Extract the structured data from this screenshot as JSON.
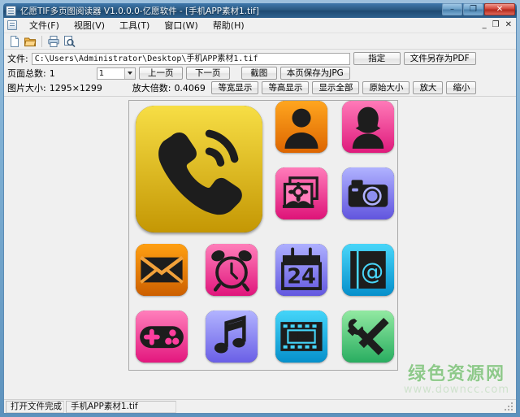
{
  "window": {
    "title": "亿愿TIF多页图阅读器 V1.0.0.0-亿愿软件 - [手机APP素材1.tif]",
    "icon": "app-icon",
    "minimize": "–",
    "maximize": "❐",
    "close": "✕"
  },
  "mdi": {
    "minimize": "_",
    "restore": "❐",
    "close": "✕"
  },
  "menu": {
    "items": [
      {
        "label": "文件(F)",
        "name": "menu-file"
      },
      {
        "label": "视图(V)",
        "name": "menu-view"
      },
      {
        "label": "工具(T)",
        "name": "menu-tools"
      },
      {
        "label": "窗口(W)",
        "name": "menu-window"
      },
      {
        "label": "帮助(H)",
        "name": "menu-help"
      }
    ]
  },
  "toolbar": {
    "icons": [
      "new-file-icon",
      "open-folder-icon",
      "print-icon",
      "print-preview-icon"
    ]
  },
  "file_row": {
    "label": "文件:",
    "path": "C:\\Users\\Administrator\\Desktop\\手机APP素材1.tif",
    "placeholder": "",
    "specify_button": "指定",
    "save_pdf_button": "文件另存为PDF"
  },
  "page_row": {
    "total_label": "页面总数:",
    "total_value": "1",
    "page_select_value": "1",
    "prev_button": "上一页",
    "next_button": "下一页",
    "capture_button": "截图",
    "save_jpg_button": "本页保存为JPG"
  },
  "zoom_row": {
    "size_label": "图片大小:",
    "size_value": "1295×1299",
    "scale_label": "放大倍数:",
    "scale_value": "0.4069",
    "fit_width_button": "等宽显示",
    "fit_height_button": "等高显示",
    "fit_all_button": "显示全部",
    "original_size_button": "原始大小",
    "zoom_in_button": "放大",
    "zoom_out_button": "缩小"
  },
  "image": {
    "icons": [
      {
        "name": "phone-icon",
        "c1": "#f5d93a",
        "c2": "#c79a05",
        "span": "big"
      },
      {
        "name": "contact-male-icon",
        "c1": "#ff9f1a",
        "c2": "#e06a00"
      },
      {
        "name": "contact-female-icon",
        "c1": "#ff74b4",
        "c2": "#e11f7e"
      },
      {
        "name": "gallery-icon",
        "c1": "#ff77b9",
        "c2": "#e01579"
      },
      {
        "name": "camera-icon",
        "c1": "#a6a8f8",
        "c2": "#6a5fe0"
      },
      {
        "name": "mail-icon",
        "c1": "#ff9a0d",
        "c2": "#cf6200"
      },
      {
        "name": "alarm-clock-icon",
        "c1": "#ff79b5",
        "c2": "#e3187c"
      },
      {
        "name": "calendar-icon",
        "c1": "#a4a6f9",
        "c2": "#6a5fe2",
        "day": "24"
      },
      {
        "name": "contacts-book-icon",
        "c1": "#41d2f7",
        "c2": "#0a93cd"
      },
      {
        "name": "gamepad-icon",
        "c1": "#ff7ab7",
        "c2": "#e3167c"
      },
      {
        "name": "music-icon",
        "c1": "#a8aafa",
        "c2": "#6d62e4"
      },
      {
        "name": "video-icon",
        "c1": "#3fd3f8",
        "c2": "#0a92cd"
      },
      {
        "name": "tools-icon",
        "c1": "#8ce59a",
        "c2": "#2fae63"
      }
    ]
  },
  "watermark": {
    "title": "绿色资源网",
    "url": "www.downcc.com"
  },
  "status": {
    "message": "打开文件完成",
    "filename": "手机APP素材1.tif"
  }
}
